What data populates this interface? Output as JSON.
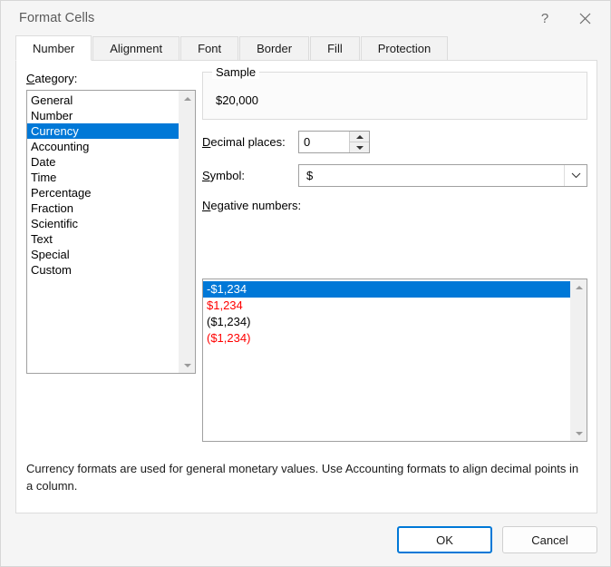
{
  "window": {
    "title": "Format Cells",
    "help_icon": "question-mark-icon",
    "close_icon": "close-icon"
  },
  "tabs": [
    {
      "label": "Number",
      "active": true
    },
    {
      "label": "Alignment",
      "active": false
    },
    {
      "label": "Font",
      "active": false
    },
    {
      "label": "Border",
      "active": false
    },
    {
      "label": "Fill",
      "active": false
    },
    {
      "label": "Protection",
      "active": false
    }
  ],
  "category": {
    "label": "Category:",
    "accesskey": "C",
    "items": [
      "General",
      "Number",
      "Currency",
      "Accounting",
      "Date",
      "Time",
      "Percentage",
      "Fraction",
      "Scientific",
      "Text",
      "Special",
      "Custom"
    ],
    "selected": "Currency",
    "selected_index": 2
  },
  "sample": {
    "group_title": "Sample",
    "value": "$20,000"
  },
  "decimal_places": {
    "label": "Decimal places:",
    "accesskey": "D",
    "value": "0",
    "spinner_up_icon": "triangle-up-icon",
    "spinner_down_icon": "triangle-down-icon"
  },
  "symbol": {
    "label": "Symbol:",
    "accesskey": "S",
    "value": "$",
    "dropdown_icon": "chevron-down-icon"
  },
  "negative_numbers": {
    "label": "Negative numbers:",
    "accesskey": "N",
    "items": [
      {
        "text": "-$1,234",
        "color": "#000000",
        "selected": true
      },
      {
        "text": "$1,234",
        "color": "#ff0000",
        "selected": false
      },
      {
        "text": "($1,234)",
        "color": "#000000",
        "selected": false
      },
      {
        "text": "($1,234)",
        "color": "#ff0000",
        "selected": false
      }
    ],
    "selected_index": 0
  },
  "description": "Currency formats are used for general monetary values.  Use Accounting formats to align decimal points in a column.",
  "footer": {
    "ok_label": "OK",
    "cancel_label": "Cancel"
  },
  "colors": {
    "selection_blue": "#0078d7",
    "negative_red": "#ff0000",
    "focus_border": "#0078d7"
  }
}
